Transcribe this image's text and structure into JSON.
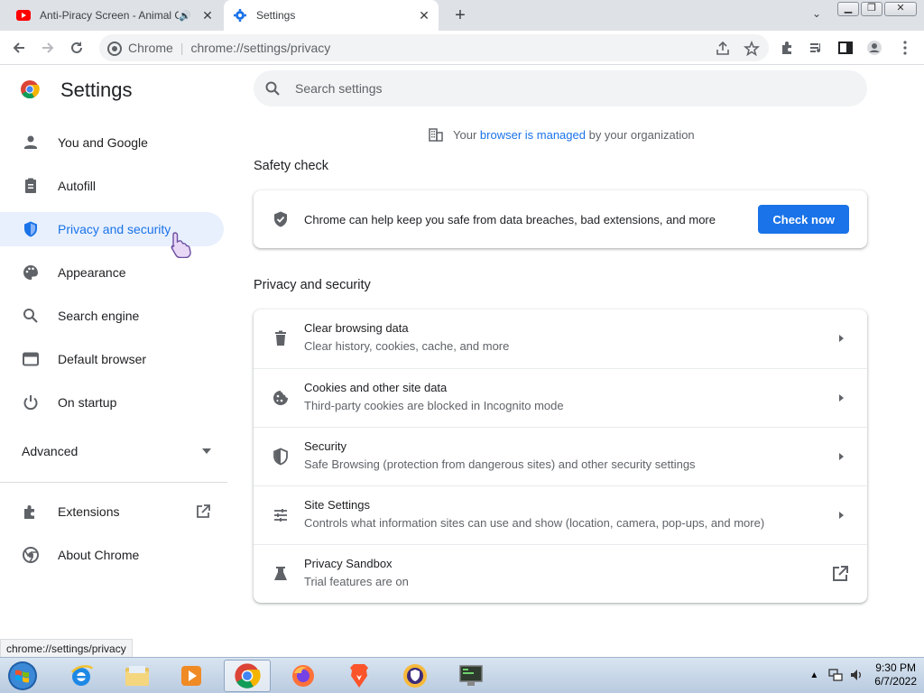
{
  "tabs": [
    {
      "title": "Anti-Piracy Screen - Animal C",
      "active": false
    },
    {
      "title": "Settings",
      "active": true
    }
  ],
  "omnibox": {
    "site": "Chrome",
    "url": "chrome://settings/privacy"
  },
  "sidebar": {
    "title": "Settings",
    "items": [
      {
        "label": "You and Google",
        "icon": "person-icon"
      },
      {
        "label": "Autofill",
        "icon": "clipboard-icon"
      },
      {
        "label": "Privacy and security",
        "icon": "shield-icon",
        "selected": true
      },
      {
        "label": "Appearance",
        "icon": "palette-icon"
      },
      {
        "label": "Search engine",
        "icon": "search-icon"
      },
      {
        "label": "Default browser",
        "icon": "browser-icon"
      },
      {
        "label": "On startup",
        "icon": "power-icon"
      }
    ],
    "advanced_label": "Advanced",
    "extensions_label": "Extensions",
    "about_label": "About Chrome"
  },
  "search": {
    "placeholder": "Search settings"
  },
  "managed": {
    "prefix": "Your ",
    "link": "browser is managed",
    "suffix": " by your organization"
  },
  "safety_check": {
    "title": "Safety check",
    "text": "Chrome can help keep you safe from data breaches, bad extensions, and more",
    "button": "Check now"
  },
  "privacy": {
    "title": "Privacy and security",
    "rows": [
      {
        "title": "Clear browsing data",
        "subtitle": "Clear history, cookies, cache, and more"
      },
      {
        "title": "Cookies and other site data",
        "subtitle": "Third-party cookies are blocked in Incognito mode"
      },
      {
        "title": "Security",
        "subtitle": "Safe Browsing (protection from dangerous sites) and other security settings"
      },
      {
        "title": "Site Settings",
        "subtitle": "Controls what information sites can use and show (location, camera, pop-ups, and more)"
      },
      {
        "title": "Privacy Sandbox",
        "subtitle": "Trial features are on"
      }
    ]
  },
  "status_tip": "chrome://settings/privacy",
  "clock": {
    "time": "9:30 PM",
    "date": "6/7/2022"
  },
  "colors": {
    "accent": "#1a73e8",
    "selected_bg": "#e8f0fe"
  }
}
